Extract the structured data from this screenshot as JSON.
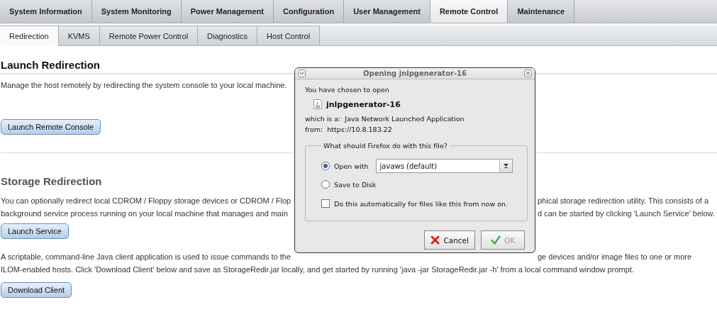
{
  "main_tabs": [
    {
      "label": "System Information",
      "selected": false
    },
    {
      "label": "System Monitoring",
      "selected": false
    },
    {
      "label": "Power Management",
      "selected": false
    },
    {
      "label": "Configuration",
      "selected": false
    },
    {
      "label": "User Management",
      "selected": false
    },
    {
      "label": "Remote Control",
      "selected": true
    },
    {
      "label": "Maintenance",
      "selected": false
    }
  ],
  "sub_tabs": [
    {
      "label": "Redirection",
      "selected": true
    },
    {
      "label": "KVMS",
      "selected": false
    },
    {
      "label": "Remote Power Control",
      "selected": false
    },
    {
      "label": "Diagnostics",
      "selected": false
    },
    {
      "label": "Host Control",
      "selected": false
    }
  ],
  "launch_redirection": {
    "heading": "Launch Redirection",
    "description": [
      {
        "left": "Manage the host remotely by redirecting the system console to your local machine."
      }
    ],
    "button": "Launch Remote Console"
  },
  "storage_redirection": {
    "heading": "Storage Redirection",
    "service_text": [
      {
        "left": "You can optionally redirect local CDROM / Floppy storage devices or CDROM / Flop",
        "right": "phical storage redirection utility. This consists of a"
      },
      {
        "left": "background service process running on your local machine that manages and main",
        "right": "d can be started by clicking 'Launch Service' below."
      }
    ],
    "service_button": "Launch Service",
    "client_text": [
      {
        "left": "A scriptable, command-line Java client application is used to issue commands to the",
        "right": "ge devices and/or image files to one or more"
      },
      {
        "left": "ILOM-enabled hosts. Click 'Download Client' below and save as StorageRedir.jar locally, and get started by running 'java -jar StorageRedir.jar -h' from a local command window prompt."
      }
    ],
    "client_button": "Download Client"
  },
  "dialog": {
    "title": "Opening jnlpgenerator-16",
    "intro": "You have chosen to open",
    "file_name": "jnlpgenerator-16",
    "type_label": "which is a:",
    "type_value": "Java Network Launched Application",
    "from_label": "from:",
    "from_value": "https://10.8.183.22",
    "group_label": "What should Firefox do with this file?",
    "options": [
      {
        "label": "Open with",
        "selected": true,
        "app": "javaws (default)"
      },
      {
        "label": "Save to Disk",
        "selected": false
      }
    ],
    "remember": {
      "label": "Do this automatically for files like this from now on.",
      "checked": false
    },
    "buttons": [
      {
        "label": "Cancel",
        "kind": "cancel",
        "disabled": false
      },
      {
        "label": "OK",
        "kind": "ok",
        "disabled": true
      }
    ]
  }
}
